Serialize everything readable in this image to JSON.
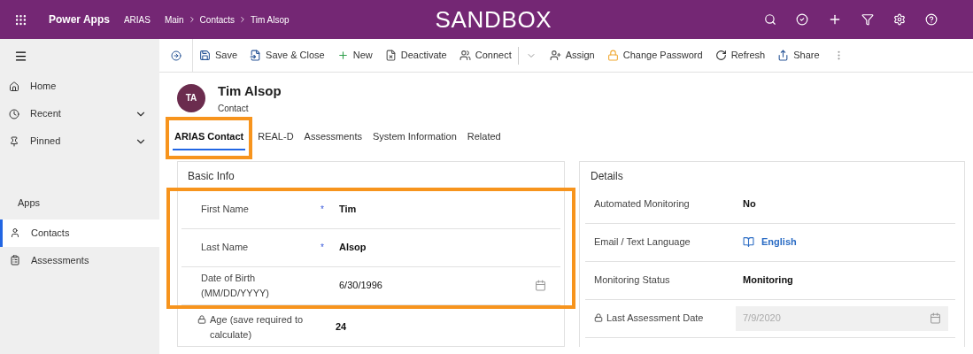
{
  "top_bar": {
    "app_name": "Power Apps",
    "environment": "ARIAS",
    "breadcrumb": [
      "Main",
      "Contacts",
      "Tim Alsop"
    ],
    "banner": "SANDBOX"
  },
  "sidebar": {
    "nav": [
      {
        "label": "Home",
        "has_submenu": false,
        "selected": false
      },
      {
        "label": "Recent",
        "has_submenu": true,
        "selected": false
      },
      {
        "label": "Pinned",
        "has_submenu": true,
        "selected": false
      }
    ],
    "section_title": "Apps",
    "apps": [
      {
        "label": "Contacts",
        "selected": true
      },
      {
        "label": "Assessments",
        "selected": false
      }
    ]
  },
  "toolbar": [
    {
      "label": "Save",
      "kind": "button"
    },
    {
      "label": "Save & Close",
      "kind": "button"
    },
    {
      "label": "New",
      "kind": "button"
    },
    {
      "label": "Deactivate",
      "kind": "button"
    },
    {
      "label": "Connect",
      "kind": "split"
    },
    {
      "label": "Assign",
      "kind": "button"
    },
    {
      "label": "Change Password",
      "kind": "button"
    },
    {
      "label": "Refresh",
      "kind": "button"
    },
    {
      "label": "Share",
      "kind": "button"
    }
  ],
  "record": {
    "initials": "TA",
    "name": "Tim Alsop",
    "entity": "Contact"
  },
  "tabs": [
    {
      "label": "ARIAS Contact",
      "selected": true,
      "highlighted": true
    },
    {
      "label": "REAL-D",
      "selected": false,
      "highlighted": false
    },
    {
      "label": "Assessments",
      "selected": false,
      "highlighted": false
    },
    {
      "label": "System Information",
      "selected": false,
      "highlighted": false
    },
    {
      "label": "Related",
      "selected": false,
      "highlighted": false
    }
  ],
  "basic_info": {
    "title": "Basic Info",
    "groups": [
      {
        "highlighted": true,
        "fields": [
          {
            "label": "First Name",
            "required_mark": "*",
            "value": "Tim",
            "kind": "text",
            "locked": false,
            "disabled": false
          },
          {
            "label": "Last Name",
            "required_mark": "*",
            "value": "Alsop",
            "kind": "text",
            "locked": false,
            "disabled": false
          },
          {
            "label": "Date of Birth (MM/DD/YYYY)",
            "value": "6/30/1996",
            "kind": "date",
            "locked": false,
            "disabled": false
          }
        ]
      },
      {
        "highlighted": false,
        "fields": [
          {
            "label": "Age (save required to calculate)",
            "value": "24",
            "kind": "text",
            "locked": true,
            "disabled": false
          }
        ]
      }
    ]
  },
  "details": {
    "title": "Details",
    "fields": [
      {
        "label": "Automated Monitoring",
        "value": "No",
        "kind": "text",
        "locked": false,
        "disabled": false
      },
      {
        "label": "Email / Text Language",
        "value": "English",
        "kind": "lookup",
        "locked": false,
        "disabled": false
      },
      {
        "label": "Monitoring Status",
        "value": "Monitoring",
        "kind": "text",
        "locked": false,
        "disabled": false
      },
      {
        "label": "Last Assessment Date",
        "value": "7/9/2020",
        "kind": "date",
        "locked": true,
        "disabled": true
      }
    ]
  }
}
